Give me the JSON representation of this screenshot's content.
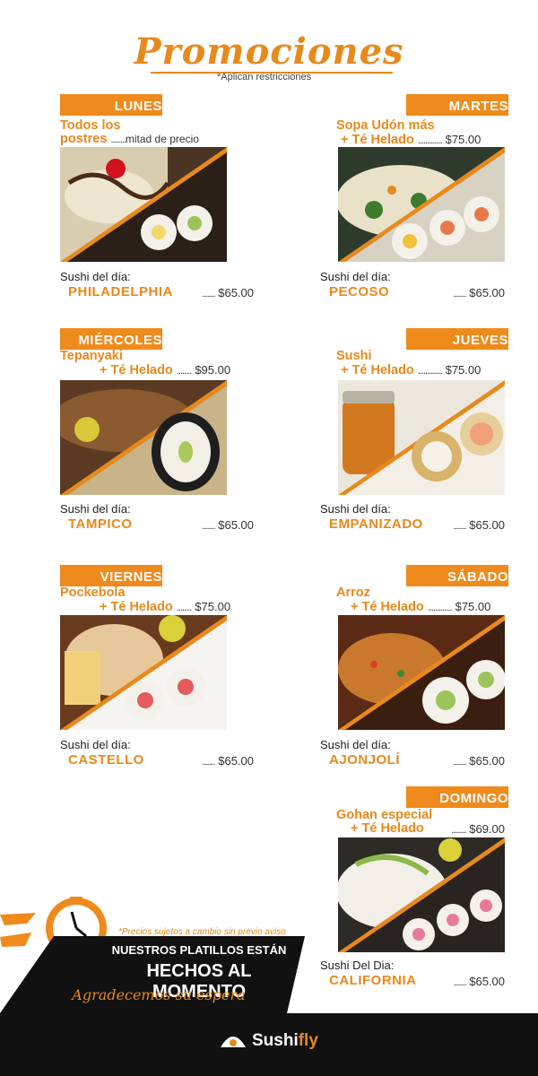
{
  "header": {
    "title": "Promociones",
    "subtitle": "*Aplican restricciones"
  },
  "days": [
    {
      "day": "LUNES",
      "promo_lines": [
        "Todos los",
        "postres"
      ],
      "dots": "........",
      "price": "mitad de precio",
      "sushi_label": "Sushi del día:",
      "sushi_name": "PHILADELPHIA",
      "sushi_dots": "........",
      "sushi_price": "$65.00"
    },
    {
      "day": "MARTES",
      "promo_lines": [
        "Sopa Udón más",
        "+ Té Helado"
      ],
      "dots": ".............",
      "price": "$75.00",
      "sushi_label": "Sushi del día:",
      "sushi_name": "PECOSO",
      "sushi_dots": "........",
      "sushi_price": "$65.00"
    },
    {
      "day": "MIÉRCOLES",
      "promo_lines": [
        "Tepanyaki",
        "+ Té Helado"
      ],
      "dots": "........",
      "price": "$95.00",
      "sushi_label": "Sushi del día:",
      "sushi_name": "TAMPICO",
      "sushi_dots": "........",
      "sushi_price": "$65.00"
    },
    {
      "day": "JUEVES",
      "promo_lines": [
        "Sushi",
        "+ Té Helado"
      ],
      "dots": ".............",
      "price": "$75.00",
      "sushi_label": "Sushi del día:",
      "sushi_name": "EMPANIZADO",
      "sushi_dots": "........",
      "sushi_price": "$65.00"
    },
    {
      "day": "VIERNES",
      "promo_lines": [
        "Pockebola",
        "+ Té Helado"
      ],
      "dots": "........",
      "price": "$75.00",
      "sushi_label": "Sushi del día:",
      "sushi_name": "CASTELLO",
      "sushi_dots": "........",
      "sushi_price": "$65.00"
    },
    {
      "day": "SÁBADO",
      "promo_lines": [
        "Arroz",
        "+ Té Helado"
      ],
      "dots": ".............",
      "price": "$75.00",
      "sushi_label": "Sushi del día:",
      "sushi_name": "AJONJOLÍ",
      "sushi_dots": "........",
      "sushi_price": "$65.00"
    },
    {
      "day": "DOMINGO",
      "promo_lines": [
        "Gohan especial",
        "+ Té Helado"
      ],
      "dots": "........",
      "price": "$69.00",
      "sushi_label": "Sushi Del Dia:",
      "sushi_name": "CALIFORNIA",
      "sushi_dots": "........",
      "sushi_price": "$65.00"
    }
  ],
  "banner": {
    "note": "*Precios sujetos a cambio sin previo aviso",
    "line1": "NUESTROS PLATILLOS ESTÁN",
    "line2": "HECHOS AL MOMENTO",
    "line3": "Agradecemos su espera"
  },
  "footer": {
    "brand_a": "Sushi",
    "brand_b": "fly"
  },
  "colors": {
    "accent": "#ef8a1c",
    "dark": "#111111"
  },
  "icons": [
    "clock-icon",
    "sushi-logo-icon"
  ]
}
